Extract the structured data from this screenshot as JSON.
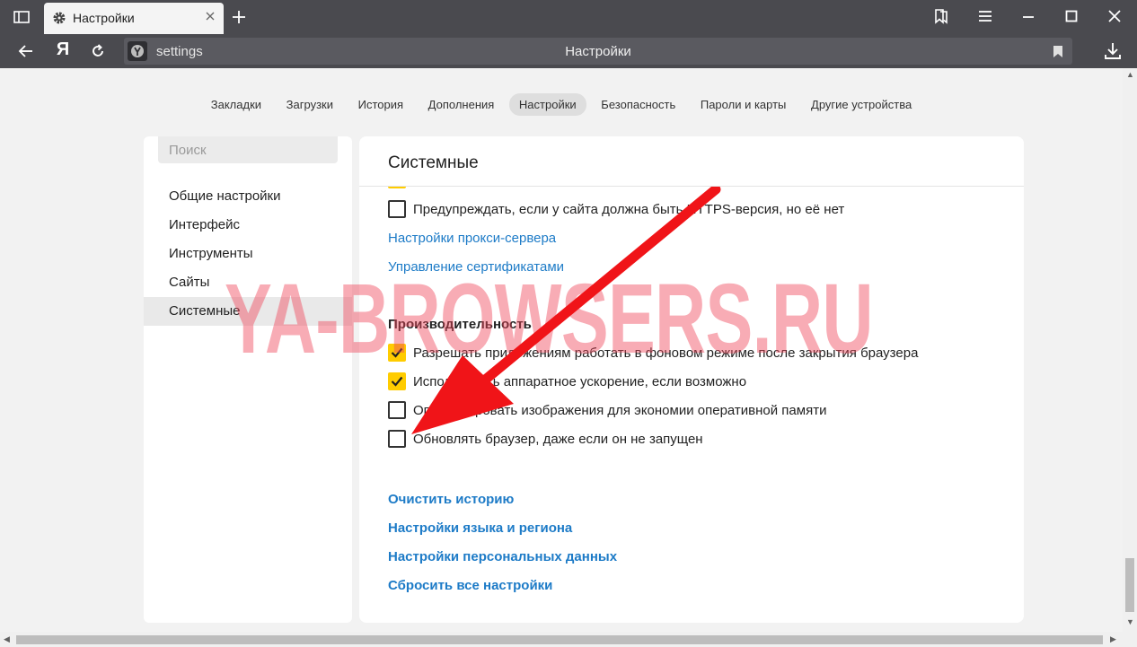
{
  "window": {
    "tab_title": "Настройки",
    "url": "settings",
    "page_title": "Настройки"
  },
  "topnav": {
    "items": [
      "Закладки",
      "Загрузки",
      "История",
      "Дополнения",
      "Настройки",
      "Безопасность",
      "Пароли и карты",
      "Другие устройства"
    ],
    "active_index": 4
  },
  "sidebar": {
    "search_placeholder": "Поиск",
    "items": [
      "Общие настройки",
      "Интерфейс",
      "Инструменты",
      "Сайты",
      "Системные"
    ],
    "active_index": 4
  },
  "panel": {
    "title": "Системные",
    "https_warning": {
      "label": "Предупреждать, если у сайта должна быть HTTPS-версия, но её нет",
      "checked": false
    },
    "proxy_link": "Настройки прокси-сервера",
    "certs_link": "Управление сертификатами",
    "performance": {
      "title": "Производительность",
      "options": [
        {
          "label": "Разрешать приложениям работать в фоновом режиме после закрытия браузера",
          "checked": true
        },
        {
          "label": "Использовать аппаратное ускорение, если возможно",
          "checked": true
        },
        {
          "label": "Оптимизировать изображения для экономии оперативной памяти",
          "checked": false
        },
        {
          "label": "Обновлять браузер, даже если он не запущен",
          "checked": false
        }
      ]
    },
    "links": [
      "Очистить историю",
      "Настройки языка и региона",
      "Настройки персональных данных",
      "Сбросить все настройки"
    ]
  },
  "watermark": "YA-BROWSERS.RU",
  "colors": {
    "chrome": "#4a4a4f",
    "link": "#1d7bc7",
    "checkbox_checked": "#ffcc00",
    "arrow": "#f01418",
    "watermark": "#f0465a"
  },
  "icons": [
    "sidebar-toggle-icon",
    "gear-icon",
    "close-icon",
    "plus-icon",
    "bookmarks-panel-icon",
    "menu-icon",
    "minimize-icon",
    "maximize-icon",
    "back-arrow-icon",
    "yandex-logo-icon",
    "reload-icon",
    "yandex-site-icon",
    "bookmark-icon",
    "download-icon",
    "checkmark-icon"
  ]
}
